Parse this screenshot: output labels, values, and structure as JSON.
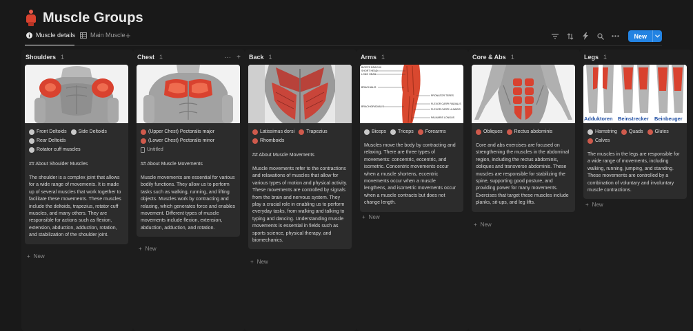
{
  "page": {
    "title": "Muscle Groups",
    "icon": "muscle-figure-icon"
  },
  "tabs": [
    {
      "label": "Muscle details",
      "icon": "info-icon",
      "active": true
    },
    {
      "label": "Main Muscle",
      "icon": "table-icon",
      "active": false
    }
  ],
  "toolbar": {
    "new_label": "New"
  },
  "columns": [
    {
      "title": "Shoulders",
      "count": "1",
      "props": [
        "Front Deltoids",
        "Side Deltoids",
        "Rear Deltoids",
        "Rotator cuff muscles"
      ],
      "heading": "## About Shoulder Muscles",
      "body": "The shoulder is a complex joint that allows for a wide range of movements. It is made up of several muscles that work together to facilitate these movements. These muscles include the deltoids, trapezius, rotator cuff muscles, and many others. They are responsible for actions such as flexion, extension, abduction, adduction, rotation, and stabilization of the shoulder joint.",
      "add_label": "New"
    },
    {
      "title": "Chest",
      "count": "1",
      "props": [
        "(Upper Chest) Pectoralis major",
        "(Lower Chest) Pectoralis minor",
        "Untitled"
      ],
      "heading": "## About Muscle Movements",
      "body": "Muscle movements are essential for various bodily functions. They allow us to perform tasks such as walking, running, and lifting objects. Muscles work by contracting and relaxing, which generates force and enables movement. Different types of muscle movements include flexion, extension, abduction, adduction, and rotation.",
      "add_label": "New"
    },
    {
      "title": "Back",
      "count": "1",
      "props": [
        "Latissimus dorsi",
        "Trapezius",
        "Rhomboids"
      ],
      "heading": "## About Muscle Movements",
      "body": "Muscle movements refer to the contractions and relaxations of muscles that allow for various types of motion and physical activity. These movements are controlled by signals from the brain and nervous system. They play a crucial role in enabling us to perform everyday tasks, from walking and talking to typing and dancing. Understanding muscle movements is essential in fields such as sports science, physical therapy, and biomechanics.",
      "add_label": "New"
    },
    {
      "title": "Arms",
      "count": "1",
      "props": [
        "Biceps",
        "Triceps",
        "Forearms"
      ],
      "heading": "",
      "body": "Muscles move the body by contracting and relaxing. There are three types of movements: concentric, eccentric, and isometric. Concentric movements occur when a muscle shortens, eccentric movements occur when a muscle lengthens, and isometric movements occur when a muscle contracts but does not change length.",
      "add_label": "New",
      "diagram_labels": [
        "BICEPS BRACHII",
        "SHORT HEAD",
        "LONG HEAD",
        "BRACHIALIS",
        "PRONATOR TERES",
        "FLEXOR CARPI RADIALIS",
        "BRACHIORADIALIS",
        "FLEXOR CARPI ULNARIS",
        "PALMARIS LONGUS"
      ]
    },
    {
      "title": "Core & Abs",
      "count": "1",
      "props": [
        "Obliques",
        "Rectus abdominis"
      ],
      "heading": "",
      "body": "Core and abs exercises are focused on strengthening the muscles in the abdominal region, including the rectus abdominis, obliques and transverse abdominis. These muscles are responsible for stabilizing the spine, supporting good posture, and providing power for many movements. Exercises that target these muscles include planks, sit-ups, and leg lifts.",
      "add_label": "New"
    },
    {
      "title": "Legs",
      "count": "1",
      "props": [
        "Hamstring",
        "Quads",
        "Glutes",
        "Calves"
      ],
      "heading": "",
      "body": "The muscles in the legs are responsible for a wide range of movements, including walking, running, jumping, and standing. These movements are controlled by a combination of voluntary and involuntary muscle contractions.",
      "add_label": "New",
      "image_labels": [
        "Adduktoren",
        "Beinstrecker",
        "Beinbeuger"
      ]
    }
  ],
  "colors": {
    "accent": "#2383e2",
    "muscle": "#d9422f",
    "card": "#2c2c2c",
    "background": "#191919"
  }
}
